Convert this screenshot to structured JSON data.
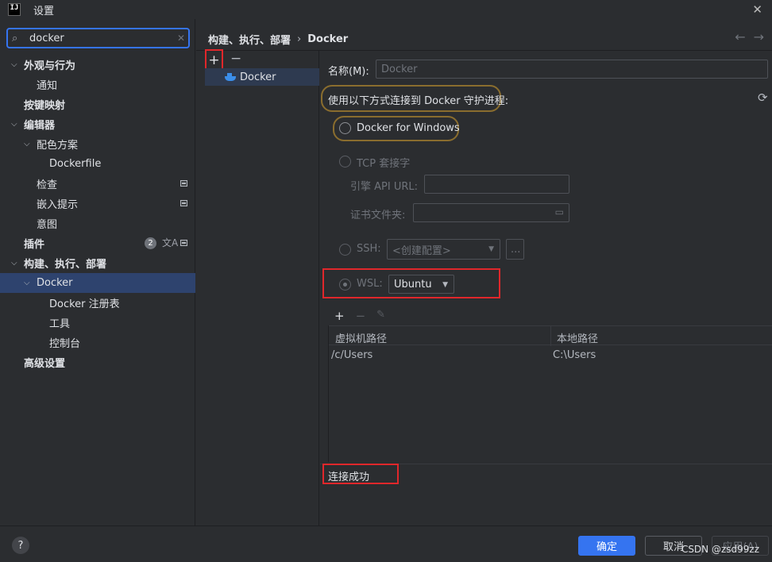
{
  "window": {
    "logo_text": "IJ",
    "title": "设置",
    "close_glyph": "✕"
  },
  "search": {
    "value": "docker",
    "icon": "search-icon",
    "clear_glyph": "✕"
  },
  "sidebar": {
    "items": [
      {
        "label": "外观与行为",
        "level": 0,
        "expanded": true,
        "bold": true
      },
      {
        "label": "通知",
        "level": 1
      },
      {
        "label": "按键映射",
        "level": 0,
        "bold": true
      },
      {
        "label": "编辑器",
        "level": 0,
        "expanded": true,
        "bold": true
      },
      {
        "label": "配色方案",
        "level": 1,
        "expanded": true
      },
      {
        "label": "Dockerfile",
        "level": 2
      },
      {
        "label": "检查",
        "level": 1
      },
      {
        "label": "嵌入提示",
        "level": 1
      },
      {
        "label": "意图",
        "level": 1
      },
      {
        "label": "插件",
        "level": 0,
        "bold": true,
        "badge": "2"
      },
      {
        "label": "构建、执行、部署",
        "level": 0,
        "expanded": true,
        "bold": true
      },
      {
        "label": "Docker",
        "level": 1,
        "expanded": true,
        "selected": true
      },
      {
        "label": "Docker 注册表",
        "level": 2
      },
      {
        "label": "工具",
        "level": 2
      },
      {
        "label": "控制台",
        "level": 2
      },
      {
        "label": "高级设置",
        "level": 0,
        "bold": true
      }
    ]
  },
  "breadcrumb": {
    "parent": "构建、执行、部署",
    "separator": "›",
    "current": "Docker",
    "back_glyph": "←",
    "forward_glyph": "→"
  },
  "list_panel": {
    "add_glyph": "+",
    "remove_glyph": "−",
    "items": [
      "Docker"
    ]
  },
  "form": {
    "name_label": "名称(M):",
    "name_value": "Docker",
    "connect_label": "使用以下方式连接到 Docker 守护进程:",
    "refresh_glyph": "⟳",
    "option_windows": "Docker for Windows",
    "option_tcp": "TCP 套接字",
    "engine_api_label": "引擎 API URL:",
    "engine_api_value": "",
    "cert_label": "证书文件夹:",
    "cert_value": "",
    "option_ssh": "SSH:",
    "ssh_placeholder": "<创建配置>",
    "ssh_more": "...",
    "option_wsl": "WSL:",
    "wsl_value": "Ubuntu",
    "selected_option": "WSL"
  },
  "mappings": {
    "add_glyph": "+",
    "remove_glyph": "−",
    "edit_glyph": "✎",
    "columns": [
      "虚拟机路径",
      "本地路径"
    ],
    "rows": [
      [
        "/c/Users",
        "C:\\Users"
      ]
    ]
  },
  "status": {
    "text": "连接成功"
  },
  "footer": {
    "help_glyph": "?",
    "ok_label": "确定",
    "cancel_label": "取消",
    "apply_label": "应用(A)",
    "watermark": "CSDN @zsd99zz"
  },
  "colors": {
    "accent": "#3574f0",
    "selection": "#2e436e",
    "highlight_red": "#e0272b",
    "highlight_gold": "#8a6d2e",
    "background": "#2b2d30"
  }
}
